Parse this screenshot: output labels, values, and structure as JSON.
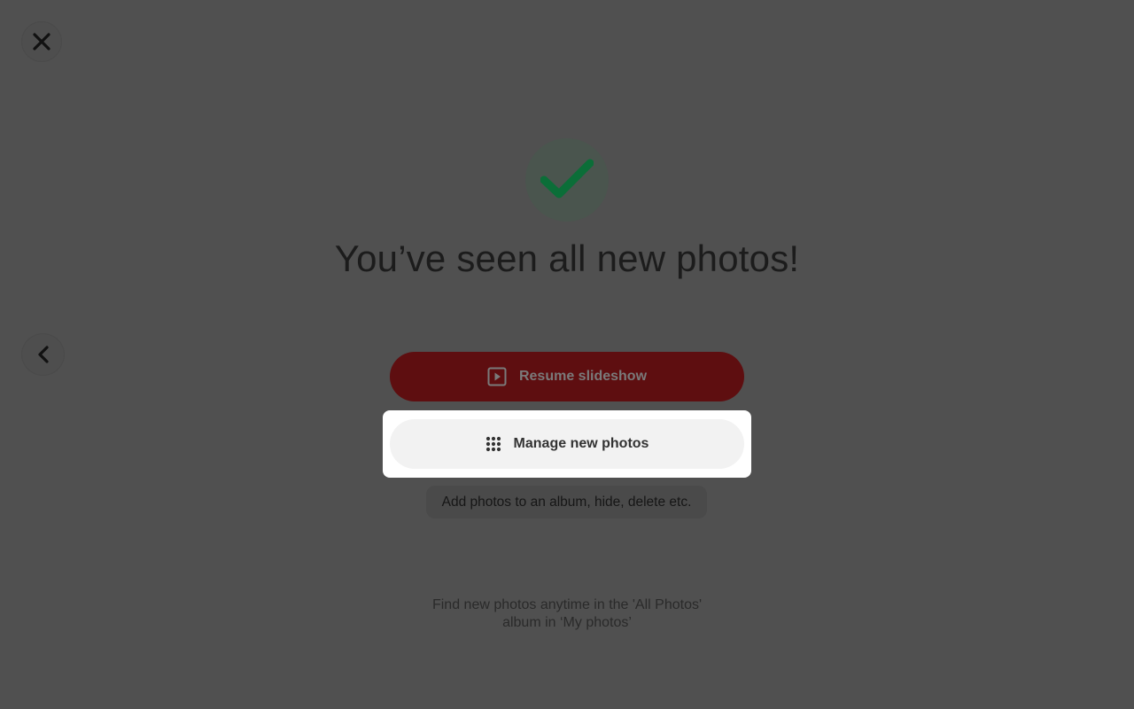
{
  "colors": {
    "overlay": "#505050",
    "accent_red": "#5e0e10",
    "check_green": "#0b6e38",
    "highlight": "#ffffff"
  },
  "nav": {
    "close_icon": "close-icon",
    "back_icon": "chevron-left-icon"
  },
  "status": {
    "icon": "checkmark-icon",
    "headline": "You’ve seen all new photos!"
  },
  "actions": {
    "resume": {
      "icon": "play-box-icon",
      "label": "Resume slideshow"
    },
    "manage": {
      "icon": "grid-dots-icon",
      "label": "Manage new photos",
      "hint": "Add photos to an album, hide, delete etc."
    }
  },
  "footer": {
    "line1": "Find new photos anytime in the 'All Photos'",
    "line2": "album in ‘My photos’"
  }
}
